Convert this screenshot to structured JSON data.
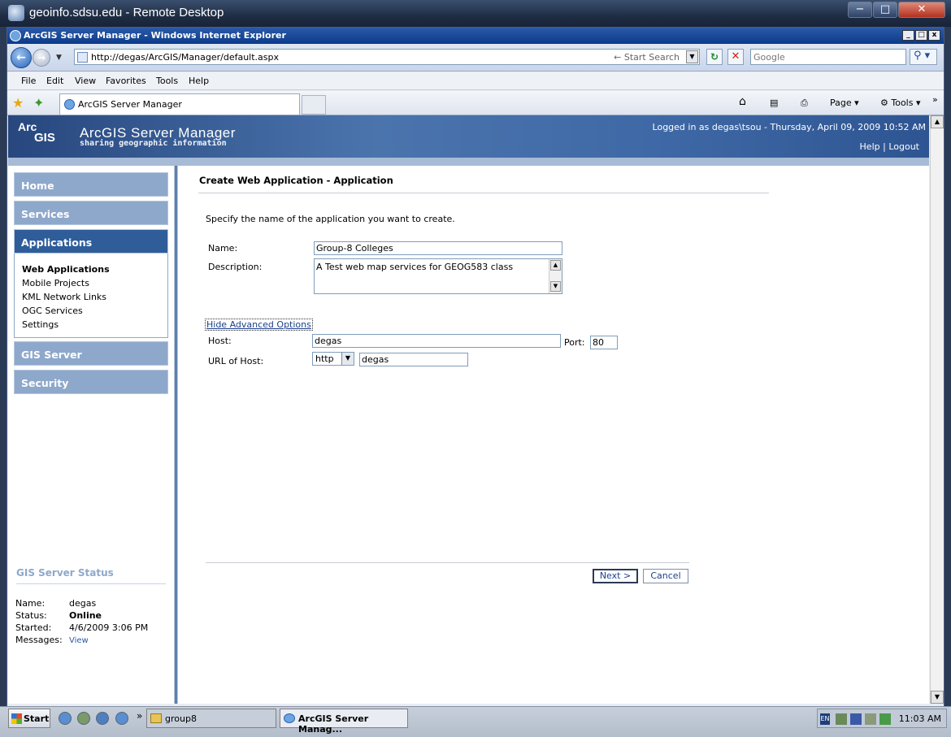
{
  "remote_desktop": {
    "title": "geoinfo.sdsu.edu - Remote Desktop",
    "btn_min": "−",
    "btn_max": "□",
    "btn_close": "✕"
  },
  "ie": {
    "title": "ArcGIS Server Manager - Windows Internet Explorer",
    "url": "http://degas/ArcGIS/Manager/default.aspx",
    "search_hint": "← Start Search",
    "search_placeholder": "Google",
    "menu": [
      "File",
      "Edit",
      "View",
      "Favorites",
      "Tools",
      "Help"
    ],
    "tab_title": "ArcGIS Server Manager",
    "cmd_page": "Page ▾",
    "cmd_tools": "Tools ▾",
    "cmd_more": "»"
  },
  "header": {
    "logo_top": "Arc",
    "logo_bottom": "GIS",
    "app_title": "ArcGIS Server Manager",
    "tagline": "sharing geographic information",
    "logged_in": "Logged in as degas\\tsou - Thursday, April 09, 2009 10:52 AM",
    "help": "Help",
    "sep": "|",
    "logout": "Logout"
  },
  "sidebar": {
    "nav": [
      "Home",
      "Services",
      "Applications",
      "GIS Server",
      "Security"
    ],
    "subnav": [
      "Web Applications",
      "Mobile Projects",
      "KML Network Links",
      "OGC Services",
      "Settings"
    ],
    "status_title": "GIS Server Status",
    "status": {
      "name_k": "Name:",
      "name_v": "degas",
      "status_k": "Status:",
      "status_v": "Online",
      "started_k": "Started:",
      "started_v": "4/6/2009 3:06 PM",
      "messages_k": "Messages:",
      "messages_v": "View"
    }
  },
  "form": {
    "title": "Create Web Application - Application",
    "intro": "Specify the name of the application you want to create.",
    "name_label": "Name:",
    "name_value": "Group-8 Colleges",
    "desc_label": "Description:",
    "desc_value": "A Test web map services for GEOG583 class",
    "adv_link": "Hide Advanced Options",
    "host_label": "Host:",
    "host_value": "degas",
    "port_label": "Port:",
    "port_value": "80",
    "url_host_label": "URL of Host:",
    "protocol": "http",
    "url_host_value": "degas",
    "next": "Next >",
    "cancel": "Cancel"
  },
  "taskbar": {
    "start": "Start",
    "more": "»",
    "folder": "group8",
    "ie": "ArcGIS Server Manag...",
    "lang": "EN",
    "clock": "11:03 AM"
  }
}
